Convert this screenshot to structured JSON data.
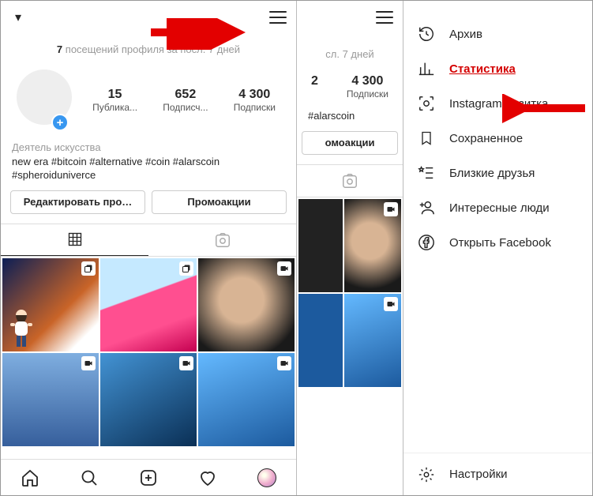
{
  "header": {
    "chevron": "▾"
  },
  "visits": {
    "count": "7",
    "text_before": "посещений профиля за посл. 7 дней"
  },
  "stats": {
    "items": [
      {
        "num": "15",
        "label": "Публика..."
      },
      {
        "num": "652",
        "label": "Подписч..."
      },
      {
        "num": "4 300",
        "label": "Подписки"
      }
    ]
  },
  "bio": {
    "category": "Деятель искусства",
    "line": "new era #bitcoin #alternative #coin #alarscoin #spheroiduniverce"
  },
  "buttons": {
    "edit": "Редактировать про…",
    "promo": "Промоакции"
  },
  "tabs": {},
  "screen2": {
    "visits_tail": "сл. 7 дней",
    "counters": [
      {
        "num": "2",
        "label": ""
      },
      {
        "num": "4 300",
        "label": "Подписки"
      }
    ],
    "bio_tail": "#alarscoin",
    "promo_tail": "омоакции"
  },
  "menu_items": [
    {
      "key": "archive",
      "label": "Архив",
      "icon": "clock"
    },
    {
      "key": "stats",
      "label": "Статистика",
      "icon": "chart",
      "highlight": true
    },
    {
      "key": "nametag",
      "label": "Instagram-визитка",
      "icon": "scan"
    },
    {
      "key": "saved",
      "label": "Сохраненное",
      "icon": "bookmark"
    },
    {
      "key": "close_friends",
      "label": "Близкие друзья",
      "icon": "starlist"
    },
    {
      "key": "discover",
      "label": "Интересные люди",
      "icon": "addperson"
    },
    {
      "key": "facebook",
      "label": "Открыть Facebook",
      "icon": "facebook"
    }
  ],
  "settings_label": "Настройки"
}
